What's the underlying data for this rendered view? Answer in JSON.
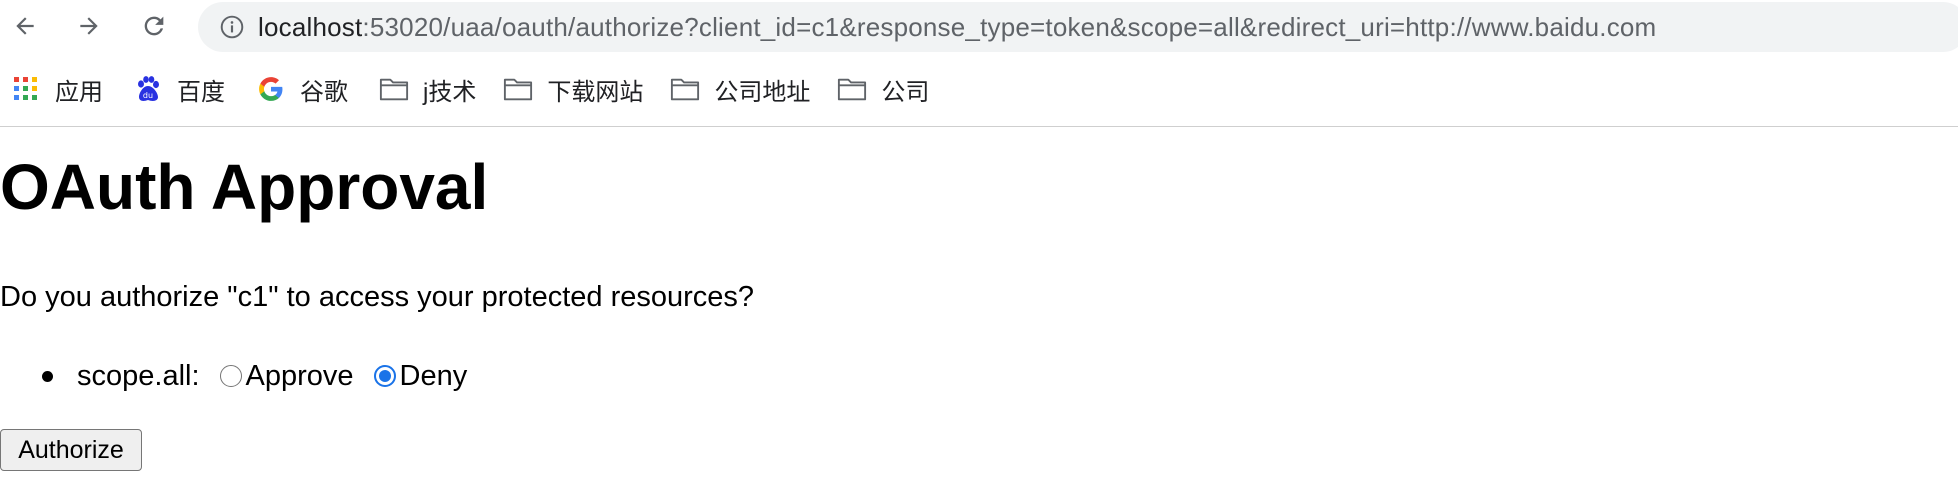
{
  "browser": {
    "url_host": "localhost",
    "url_path": ":53020/uaa/oauth/authorize?client_id=c1&response_type=token&scope=all&redirect_uri=http://www.baidu.com",
    "bookmarks": [
      {
        "label": "应用",
        "icon": "apps-grid-icon"
      },
      {
        "label": "百度",
        "icon": "baidu-paw-icon"
      },
      {
        "label": "谷歌",
        "icon": "google-g-icon"
      },
      {
        "label": "j技术",
        "icon": "folder-icon"
      },
      {
        "label": "下载网站",
        "icon": "folder-icon"
      },
      {
        "label": "公司地址",
        "icon": "folder-icon"
      },
      {
        "label": "公司",
        "icon": "folder-icon"
      }
    ]
  },
  "page": {
    "title": "OAuth Approval",
    "question": "Do you authorize \"c1\" to access your protected resources?",
    "scopes": [
      {
        "label": "scope.all:",
        "options": [
          {
            "label": "Approve",
            "checked": false
          },
          {
            "label": "Deny",
            "checked": true
          }
        ]
      }
    ],
    "submit_label": "Authorize"
  },
  "colors": {
    "accent": "#1a73e8",
    "omnibox_bg": "#f1f3f4"
  }
}
